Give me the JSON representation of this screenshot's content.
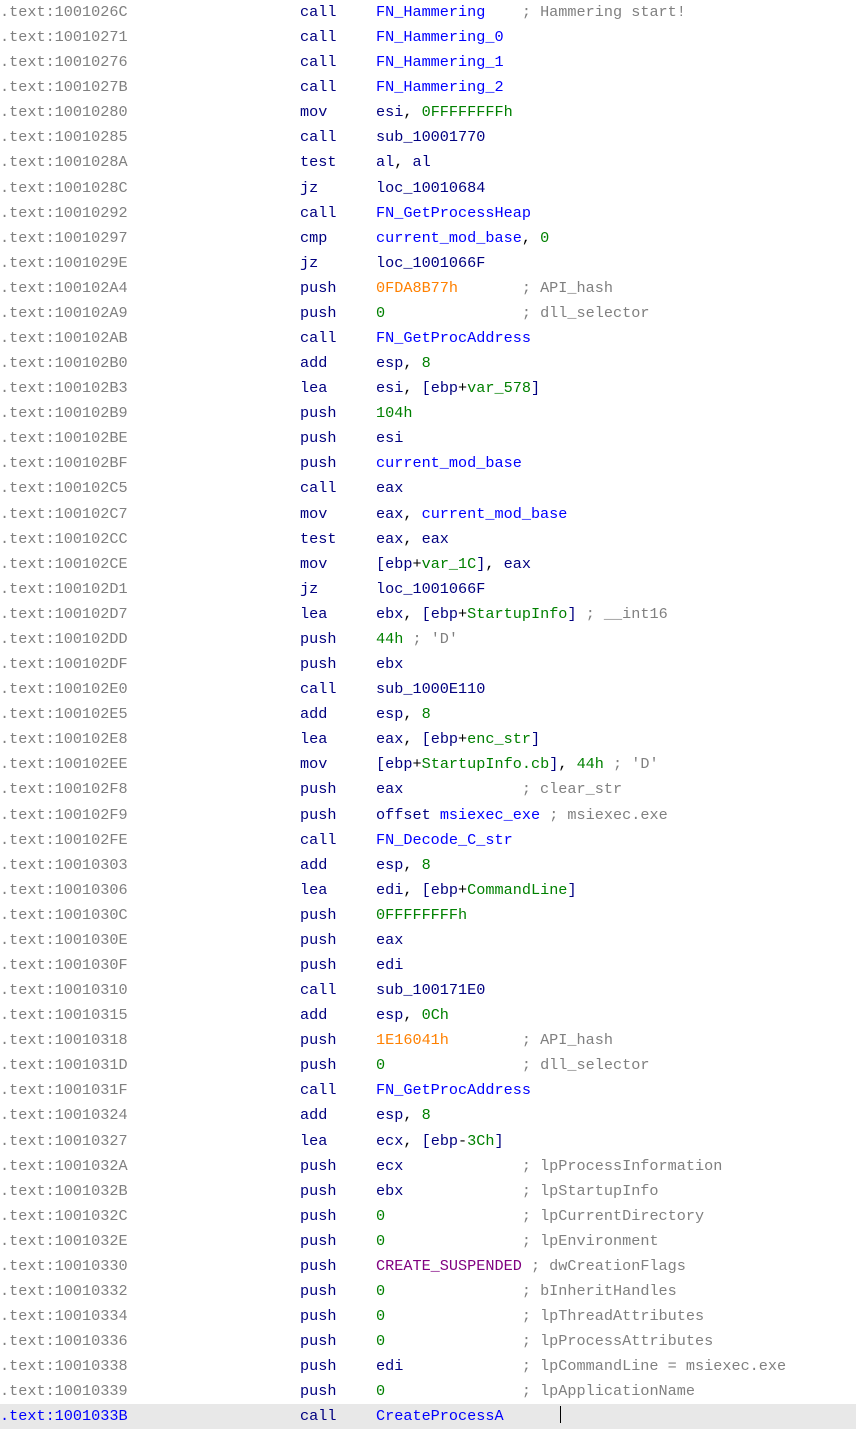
{
  "lines": [
    {
      "addr": ".text:1001026C",
      "mnem": "call",
      "ops": [
        {
          "t": "func",
          "v": "FN_Hammering"
        },
        {
          "t": "pad",
          "v": "    "
        },
        {
          "t": "cmt",
          "v": "; Hammering start!"
        }
      ]
    },
    {
      "addr": ".text:10010271",
      "mnem": "call",
      "ops": [
        {
          "t": "func",
          "v": "FN_Hammering_0"
        }
      ]
    },
    {
      "addr": ".text:10010276",
      "mnem": "call",
      "ops": [
        {
          "t": "func",
          "v": "FN_Hammering_1"
        }
      ]
    },
    {
      "addr": ".text:1001027B",
      "mnem": "call",
      "ops": [
        {
          "t": "func",
          "v": "FN_Hammering_2"
        }
      ]
    },
    {
      "addr": ".text:10010280",
      "mnem": "mov",
      "ops": [
        {
          "t": "reg",
          "v": "esi"
        },
        {
          "t": "txt",
          "v": ", "
        },
        {
          "t": "num",
          "v": "0FFFFFFFFh"
        }
      ]
    },
    {
      "addr": ".text:10010285",
      "mnem": "call",
      "ops": [
        {
          "t": "loc",
          "v": "sub_10001770"
        }
      ]
    },
    {
      "addr": ".text:1001028A",
      "mnem": "test",
      "ops": [
        {
          "t": "reg",
          "v": "al"
        },
        {
          "t": "txt",
          "v": ", "
        },
        {
          "t": "reg",
          "v": "al"
        }
      ]
    },
    {
      "addr": ".text:1001028C",
      "mnem": "jz",
      "ops": [
        {
          "t": "loc",
          "v": "loc_10010684"
        }
      ]
    },
    {
      "addr": ".text:10010292",
      "mnem": "call",
      "ops": [
        {
          "t": "func",
          "v": "FN_GetProcessHeap"
        }
      ]
    },
    {
      "addr": ".text:10010297",
      "mnem": "cmp",
      "ops": [
        {
          "t": "global",
          "v": "current_mod_base"
        },
        {
          "t": "txt",
          "v": ", "
        },
        {
          "t": "num",
          "v": "0"
        }
      ]
    },
    {
      "addr": ".text:1001029E",
      "mnem": "jz",
      "ops": [
        {
          "t": "loc",
          "v": "loc_1001066F"
        }
      ]
    },
    {
      "addr": ".text:100102A4",
      "mnem": "push",
      "ops": [
        {
          "t": "hash",
          "v": "0FDA8B77h"
        },
        {
          "t": "pad",
          "v": "       "
        },
        {
          "t": "cmt",
          "v": "; API_hash"
        }
      ]
    },
    {
      "addr": ".text:100102A9",
      "mnem": "push",
      "ops": [
        {
          "t": "num",
          "v": "0"
        },
        {
          "t": "pad",
          "v": "               "
        },
        {
          "t": "cmt",
          "v": "; dll_selector"
        }
      ]
    },
    {
      "addr": ".text:100102AB",
      "mnem": "call",
      "ops": [
        {
          "t": "func",
          "v": "FN_GetProcAddress"
        }
      ]
    },
    {
      "addr": ".text:100102B0",
      "mnem": "add",
      "ops": [
        {
          "t": "reg",
          "v": "esp"
        },
        {
          "t": "txt",
          "v": ", "
        },
        {
          "t": "num",
          "v": "8"
        }
      ]
    },
    {
      "addr": ".text:100102B3",
      "mnem": "lea",
      "ops": [
        {
          "t": "reg",
          "v": "esi"
        },
        {
          "t": "txt",
          "v": ", "
        },
        {
          "t": "punct",
          "v": "["
        },
        {
          "t": "reg",
          "v": "ebp"
        },
        {
          "t": "txt",
          "v": "+"
        },
        {
          "t": "num",
          "v": "var_578"
        },
        {
          "t": "punct",
          "v": "]"
        }
      ]
    },
    {
      "addr": ".text:100102B9",
      "mnem": "push",
      "ops": [
        {
          "t": "num",
          "v": "104h"
        }
      ]
    },
    {
      "addr": ".text:100102BE",
      "mnem": "push",
      "ops": [
        {
          "t": "reg",
          "v": "esi"
        }
      ]
    },
    {
      "addr": ".text:100102BF",
      "mnem": "push",
      "ops": [
        {
          "t": "global",
          "v": "current_mod_base"
        }
      ]
    },
    {
      "addr": ".text:100102C5",
      "mnem": "call",
      "ops": [
        {
          "t": "reg",
          "v": "eax"
        }
      ]
    },
    {
      "addr": ".text:100102C7",
      "mnem": "mov",
      "ops": [
        {
          "t": "reg",
          "v": "eax"
        },
        {
          "t": "txt",
          "v": ", "
        },
        {
          "t": "global",
          "v": "current_mod_base"
        }
      ]
    },
    {
      "addr": ".text:100102CC",
      "mnem": "test",
      "ops": [
        {
          "t": "reg",
          "v": "eax"
        },
        {
          "t": "txt",
          "v": ", "
        },
        {
          "t": "reg",
          "v": "eax"
        }
      ]
    },
    {
      "addr": ".text:100102CE",
      "mnem": "mov",
      "ops": [
        {
          "t": "punct",
          "v": "["
        },
        {
          "t": "reg",
          "v": "ebp"
        },
        {
          "t": "txt",
          "v": "+"
        },
        {
          "t": "num",
          "v": "var_1C"
        },
        {
          "t": "punct",
          "v": "]"
        },
        {
          "t": "txt",
          "v": ", "
        },
        {
          "t": "reg",
          "v": "eax"
        }
      ]
    },
    {
      "addr": ".text:100102D1",
      "mnem": "jz",
      "ops": [
        {
          "t": "loc",
          "v": "loc_1001066F"
        }
      ]
    },
    {
      "addr": ".text:100102D7",
      "mnem": "lea",
      "ops": [
        {
          "t": "reg",
          "v": "ebx"
        },
        {
          "t": "txt",
          "v": ", "
        },
        {
          "t": "punct",
          "v": "["
        },
        {
          "t": "reg",
          "v": "ebp"
        },
        {
          "t": "txt",
          "v": "+"
        },
        {
          "t": "num",
          "v": "StartupInfo"
        },
        {
          "t": "punct",
          "v": "]"
        },
        {
          "t": "txt",
          "v": " "
        },
        {
          "t": "cmt",
          "v": "; __int16"
        }
      ]
    },
    {
      "addr": ".text:100102DD",
      "mnem": "push",
      "ops": [
        {
          "t": "num",
          "v": "44h"
        },
        {
          "t": "txt",
          "v": " "
        },
        {
          "t": "cmt",
          "v": "; 'D'"
        }
      ]
    },
    {
      "addr": ".text:100102DF",
      "mnem": "push",
      "ops": [
        {
          "t": "reg",
          "v": "ebx"
        }
      ]
    },
    {
      "addr": ".text:100102E0",
      "mnem": "call",
      "ops": [
        {
          "t": "loc",
          "v": "sub_1000E110"
        }
      ]
    },
    {
      "addr": ".text:100102E5",
      "mnem": "add",
      "ops": [
        {
          "t": "reg",
          "v": "esp"
        },
        {
          "t": "txt",
          "v": ", "
        },
        {
          "t": "num",
          "v": "8"
        }
      ]
    },
    {
      "addr": ".text:100102E8",
      "mnem": "lea",
      "ops": [
        {
          "t": "reg",
          "v": "eax"
        },
        {
          "t": "txt",
          "v": ", "
        },
        {
          "t": "punct",
          "v": "["
        },
        {
          "t": "reg",
          "v": "ebp"
        },
        {
          "t": "txt",
          "v": "+"
        },
        {
          "t": "num",
          "v": "enc_str"
        },
        {
          "t": "punct",
          "v": "]"
        }
      ]
    },
    {
      "addr": ".text:100102EE",
      "mnem": "mov",
      "ops": [
        {
          "t": "punct",
          "v": "["
        },
        {
          "t": "reg",
          "v": "ebp"
        },
        {
          "t": "txt",
          "v": "+"
        },
        {
          "t": "num",
          "v": "StartupInfo.cb"
        },
        {
          "t": "punct",
          "v": "]"
        },
        {
          "t": "txt",
          "v": ", "
        },
        {
          "t": "num",
          "v": "44h"
        },
        {
          "t": "txt",
          "v": " "
        },
        {
          "t": "cmt",
          "v": "; 'D'"
        }
      ]
    },
    {
      "addr": ".text:100102F8",
      "mnem": "push",
      "ops": [
        {
          "t": "reg",
          "v": "eax"
        },
        {
          "t": "pad",
          "v": "             "
        },
        {
          "t": "cmt",
          "v": "; clear_str"
        }
      ]
    },
    {
      "addr": ".text:100102F9",
      "mnem": "push",
      "ops": [
        {
          "t": "reg",
          "v": "offset"
        },
        {
          "t": "txt",
          "v": " "
        },
        {
          "t": "global",
          "v": "msiexec_exe"
        },
        {
          "t": "txt",
          "v": " "
        },
        {
          "t": "cmt",
          "v": "; msiexec.exe"
        }
      ]
    },
    {
      "addr": ".text:100102FE",
      "mnem": "call",
      "ops": [
        {
          "t": "func",
          "v": "FN_Decode_C_str"
        }
      ]
    },
    {
      "addr": ".text:10010303",
      "mnem": "add",
      "ops": [
        {
          "t": "reg",
          "v": "esp"
        },
        {
          "t": "txt",
          "v": ", "
        },
        {
          "t": "num",
          "v": "8"
        }
      ]
    },
    {
      "addr": ".text:10010306",
      "mnem": "lea",
      "ops": [
        {
          "t": "reg",
          "v": "edi"
        },
        {
          "t": "txt",
          "v": ", "
        },
        {
          "t": "punct",
          "v": "["
        },
        {
          "t": "reg",
          "v": "ebp"
        },
        {
          "t": "txt",
          "v": "+"
        },
        {
          "t": "num",
          "v": "CommandLine"
        },
        {
          "t": "punct",
          "v": "]"
        }
      ]
    },
    {
      "addr": ".text:1001030C",
      "mnem": "push",
      "ops": [
        {
          "t": "num",
          "v": "0FFFFFFFFh"
        }
      ]
    },
    {
      "addr": ".text:1001030E",
      "mnem": "push",
      "ops": [
        {
          "t": "reg",
          "v": "eax"
        }
      ]
    },
    {
      "addr": ".text:1001030F",
      "mnem": "push",
      "ops": [
        {
          "t": "reg",
          "v": "edi"
        }
      ]
    },
    {
      "addr": ".text:10010310",
      "mnem": "call",
      "ops": [
        {
          "t": "loc",
          "v": "sub_100171E0"
        }
      ]
    },
    {
      "addr": ".text:10010315",
      "mnem": "add",
      "ops": [
        {
          "t": "reg",
          "v": "esp"
        },
        {
          "t": "txt",
          "v": ", "
        },
        {
          "t": "num",
          "v": "0Ch"
        }
      ]
    },
    {
      "addr": ".text:10010318",
      "mnem": "push",
      "ops": [
        {
          "t": "hash",
          "v": "1E16041h"
        },
        {
          "t": "pad",
          "v": "        "
        },
        {
          "t": "cmt",
          "v": "; API_hash"
        }
      ]
    },
    {
      "addr": ".text:1001031D",
      "mnem": "push",
      "ops": [
        {
          "t": "num",
          "v": "0"
        },
        {
          "t": "pad",
          "v": "               "
        },
        {
          "t": "cmt",
          "v": "; dll_selector"
        }
      ]
    },
    {
      "addr": ".text:1001031F",
      "mnem": "call",
      "ops": [
        {
          "t": "func",
          "v": "FN_GetProcAddress"
        }
      ]
    },
    {
      "addr": ".text:10010324",
      "mnem": "add",
      "ops": [
        {
          "t": "reg",
          "v": "esp"
        },
        {
          "t": "txt",
          "v": ", "
        },
        {
          "t": "num",
          "v": "8"
        }
      ]
    },
    {
      "addr": ".text:10010327",
      "mnem": "lea",
      "ops": [
        {
          "t": "reg",
          "v": "ecx"
        },
        {
          "t": "txt",
          "v": ", "
        },
        {
          "t": "punct",
          "v": "["
        },
        {
          "t": "reg",
          "v": "ebp"
        },
        {
          "t": "txt",
          "v": "-"
        },
        {
          "t": "num",
          "v": "3Ch"
        },
        {
          "t": "punct",
          "v": "]"
        }
      ]
    },
    {
      "addr": ".text:1001032A",
      "mnem": "push",
      "ops": [
        {
          "t": "reg",
          "v": "ecx"
        },
        {
          "t": "pad",
          "v": "             "
        },
        {
          "t": "cmt",
          "v": "; lpProcessInformation"
        }
      ]
    },
    {
      "addr": ".text:1001032B",
      "mnem": "push",
      "ops": [
        {
          "t": "reg",
          "v": "ebx"
        },
        {
          "t": "pad",
          "v": "             "
        },
        {
          "t": "cmt",
          "v": "; lpStartupInfo"
        }
      ]
    },
    {
      "addr": ".text:1001032C",
      "mnem": "push",
      "ops": [
        {
          "t": "num",
          "v": "0"
        },
        {
          "t": "pad",
          "v": "               "
        },
        {
          "t": "cmt",
          "v": "; lpCurrentDirectory"
        }
      ]
    },
    {
      "addr": ".text:1001032E",
      "mnem": "push",
      "ops": [
        {
          "t": "num",
          "v": "0"
        },
        {
          "t": "pad",
          "v": "               "
        },
        {
          "t": "cmt",
          "v": "; lpEnvironment"
        }
      ]
    },
    {
      "addr": ".text:10010330",
      "mnem": "push",
      "ops": [
        {
          "t": "const",
          "v": "CREATE_SUSPENDED"
        },
        {
          "t": "txt",
          "v": " "
        },
        {
          "t": "cmt",
          "v": "; dwCreationFlags"
        }
      ]
    },
    {
      "addr": ".text:10010332",
      "mnem": "push",
      "ops": [
        {
          "t": "num",
          "v": "0"
        },
        {
          "t": "pad",
          "v": "               "
        },
        {
          "t": "cmt",
          "v": "; bInheritHandles"
        }
      ]
    },
    {
      "addr": ".text:10010334",
      "mnem": "push",
      "ops": [
        {
          "t": "num",
          "v": "0"
        },
        {
          "t": "pad",
          "v": "               "
        },
        {
          "t": "cmt",
          "v": "; lpThreadAttributes"
        }
      ]
    },
    {
      "addr": ".text:10010336",
      "mnem": "push",
      "ops": [
        {
          "t": "num",
          "v": "0"
        },
        {
          "t": "pad",
          "v": "               "
        },
        {
          "t": "cmt",
          "v": "; lpProcessAttributes"
        }
      ]
    },
    {
      "addr": ".text:10010338",
      "mnem": "push",
      "ops": [
        {
          "t": "reg",
          "v": "edi"
        },
        {
          "t": "pad",
          "v": "             "
        },
        {
          "t": "cmt",
          "v": "; lpCommandLine = msiexec.exe"
        }
      ]
    },
    {
      "addr": ".text:10010339",
      "mnem": "push",
      "ops": [
        {
          "t": "num",
          "v": "0"
        },
        {
          "t": "pad",
          "v": "               "
        },
        {
          "t": "cmt",
          "v": "; lpApplicationName"
        }
      ]
    },
    {
      "addr": ".text:1001033B",
      "mnem": "call",
      "highlight": true,
      "cursor": true,
      "ops": [
        {
          "t": "func",
          "v": "CreateProcessA"
        }
      ]
    }
  ]
}
